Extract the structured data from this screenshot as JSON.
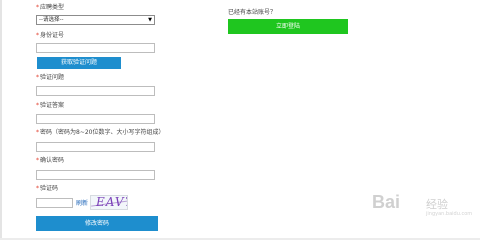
{
  "form": {
    "type_label": "应聘类型",
    "type_select_value": "--请选择--",
    "id_label": "身份证号",
    "get_question_button": "获取验证问题",
    "question_label": "验证问题",
    "answer_label": "验证答案",
    "password_label": "密码（密码为8~20位数字、大小写字符组成）",
    "confirm_label": "确认密码",
    "captcha_label": "验证码",
    "refresh_link": "刷新",
    "captcha_text": "EAV7",
    "submit_button": "修改密码"
  },
  "aside": {
    "has_account_text": "已经有本站账号？",
    "login_button": "立即登陆"
  },
  "watermark": {
    "brand": "Bai",
    "jingyan": "经验",
    "url": "jingyan.baidu.com"
  },
  "colors": {
    "required_star": "#e03b2a",
    "blue_button": "#1e8ece",
    "green_button": "#1fc61f"
  }
}
